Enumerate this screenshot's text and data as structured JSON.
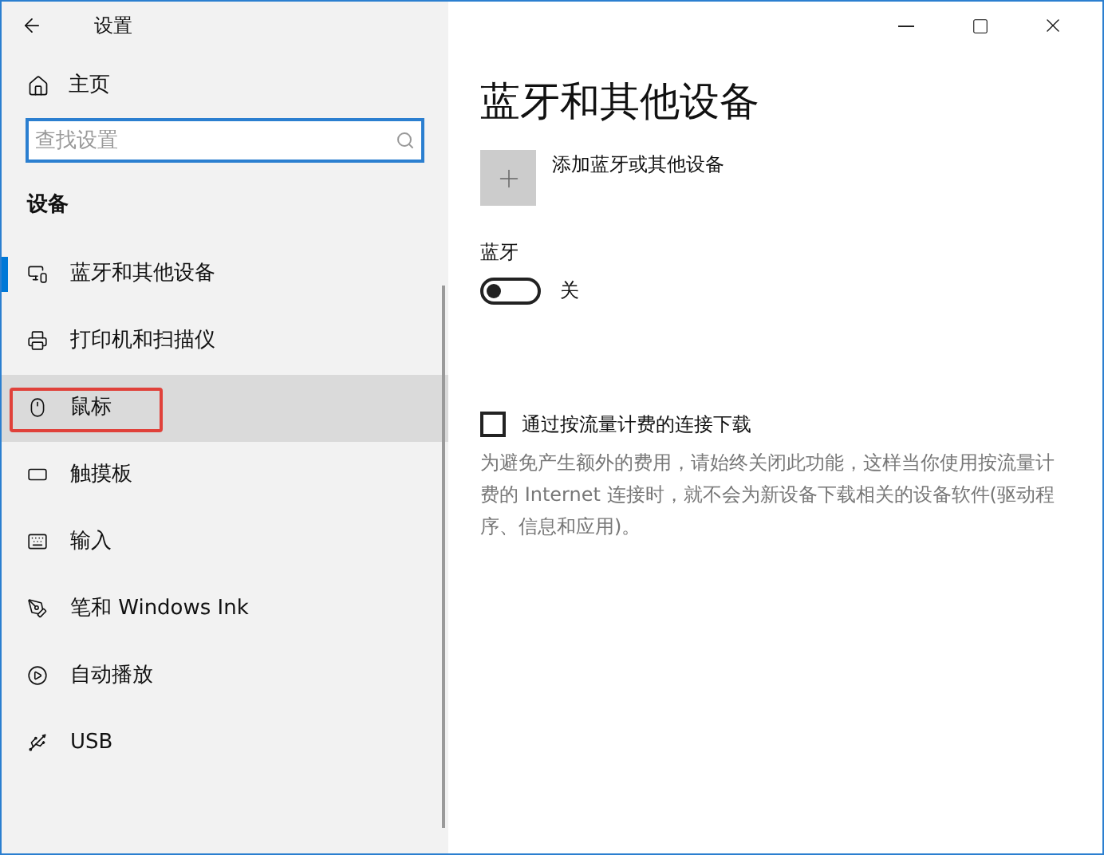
{
  "window": {
    "title": "设置"
  },
  "sidebar": {
    "home": "主页",
    "search": {
      "placeholder": "查找设置"
    },
    "section": "设备",
    "items": [
      {
        "label": "蓝牙和其他设备",
        "selected": true,
        "hovered": false,
        "highlighted": false
      },
      {
        "label": "打印机和扫描仪",
        "selected": false,
        "hovered": false,
        "highlighted": false
      },
      {
        "label": "鼠标",
        "selected": false,
        "hovered": true,
        "highlighted": true
      },
      {
        "label": "触摸板",
        "selected": false,
        "hovered": false,
        "highlighted": false
      },
      {
        "label": "输入",
        "selected": false,
        "hovered": false,
        "highlighted": false
      },
      {
        "label": "笔和 Windows Ink",
        "selected": false,
        "hovered": false,
        "highlighted": false
      },
      {
        "label": "自动播放",
        "selected": false,
        "hovered": false,
        "highlighted": false
      },
      {
        "label": "USB",
        "selected": false,
        "hovered": false,
        "highlighted": false
      }
    ]
  },
  "content": {
    "title": "蓝牙和其他设备",
    "add_device": "添加蓝牙或其他设备",
    "bluetooth": {
      "label": "蓝牙",
      "on": false,
      "state_text": "关"
    },
    "metered": {
      "label": "通过按流量计费的连接下载",
      "checked": false,
      "description": "为避免产生额外的费用，请始终关闭此功能，这样当你使用按流量计费的 Internet 连接时，就不会为新设备下载相关的设备软件(驱动程序、信息和应用)。"
    }
  }
}
